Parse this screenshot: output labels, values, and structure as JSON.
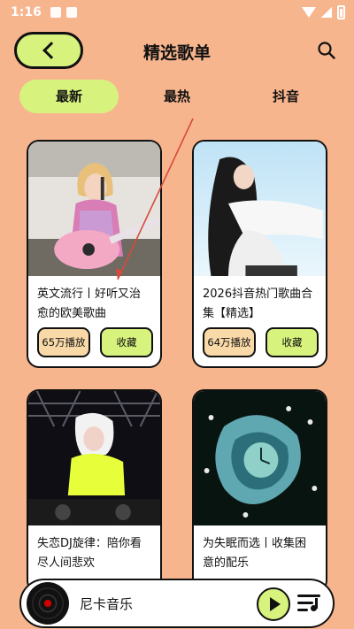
{
  "status_bar": {
    "time": "1:16"
  },
  "header": {
    "title": "精选歌单"
  },
  "tabs": [
    {
      "label": "最新",
      "active": true
    },
    {
      "label": "最热",
      "active": false
    },
    {
      "label": "抖音",
      "active": false
    }
  ],
  "playlists": [
    {
      "title": "英文流行丨好听又治愈的欧美歌曲",
      "plays": "65万播放",
      "fav_label": "收藏"
    },
    {
      "title": "2026抖音热门歌曲合集【精选】",
      "plays": "64万播放",
      "fav_label": "收藏"
    },
    {
      "title": "失恋DJ旋律：陪你看尽人间悲欢"
    },
    {
      "title": "为失眠而选丨收集困意的配乐"
    }
  ],
  "player": {
    "title": "尼卡音乐"
  },
  "colors": {
    "background": "#F7B58E",
    "accent_green": "#D7F27D",
    "plays_badge": "#F8D9A7",
    "annotation_arrow": "#D94A3A"
  }
}
